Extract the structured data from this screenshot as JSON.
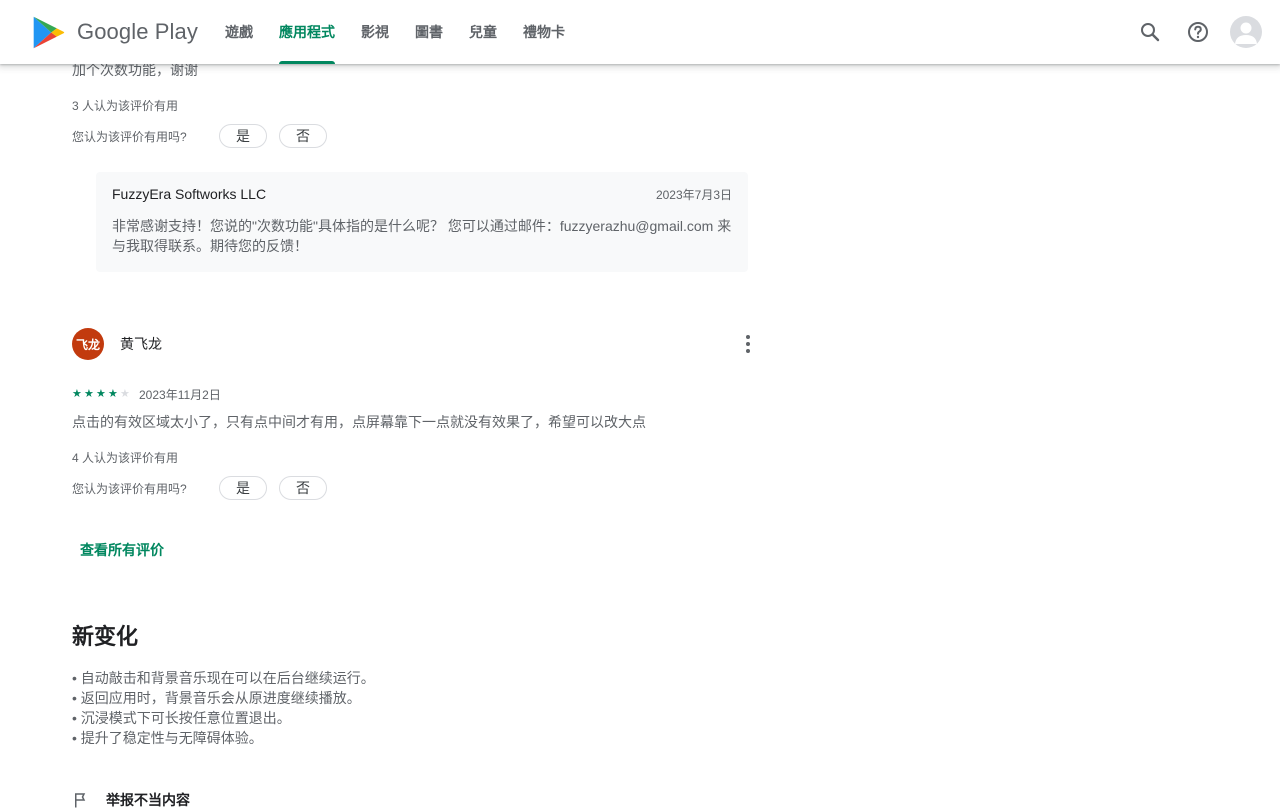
{
  "header": {
    "brand": "Google Play",
    "tabs": [
      {
        "label": "遊戲",
        "active": false
      },
      {
        "label": "應用程式",
        "active": true
      },
      {
        "label": "影視",
        "active": false
      },
      {
        "label": "圖書",
        "active": false
      },
      {
        "label": "兒童",
        "active": false
      },
      {
        "label": "禮物卡",
        "active": false
      }
    ],
    "icons": [
      "search-icon",
      "help-icon",
      "account-avatar"
    ],
    "accent_color": "#01875f"
  },
  "review1": {
    "text": "加个次数功能，谢谢",
    "helpful_count": "3 人认为该评价有用",
    "helpful_question": "您认为该评价有用吗?",
    "yes_label": "是",
    "no_label": "否",
    "developer_reply": {
      "developer": "FuzzyEra Softworks LLC",
      "date": "2023年7月3日",
      "text": "非常感谢支持！您说的\"次数功能\"具体指的是什么呢？ 您可以通过邮件：fuzzyerazhu@gmail.com 来与我取得联系。期待您的反馈！"
    }
  },
  "review2": {
    "avatar_text": "飞龙",
    "avatar_color": "#c23a0e",
    "reviewer": "黄飞龙",
    "rating": 4,
    "rating_max": 5,
    "date": "2023年11月2日",
    "text": "点击的有效区域太小了，只有点中间才有用，点屏幕靠下一点就没有效果了，希望可以改大点",
    "helpful_count": "4 人认为该评价有用",
    "helpful_question": "您认为该评价有用吗?",
    "yes_label": "是",
    "no_label": "否"
  },
  "see_all_reviews": "查看所有评价",
  "whats_new": {
    "title": "新变化",
    "items": [
      "自动敲击和背景音乐现在可以在后台继续运行。",
      "返回应用时，背景音乐会从原进度继续播放。",
      "沉浸模式下可长按任意位置退出。",
      "提升了稳定性与无障碍体验。"
    ]
  },
  "flag_label": "举报不当内容"
}
